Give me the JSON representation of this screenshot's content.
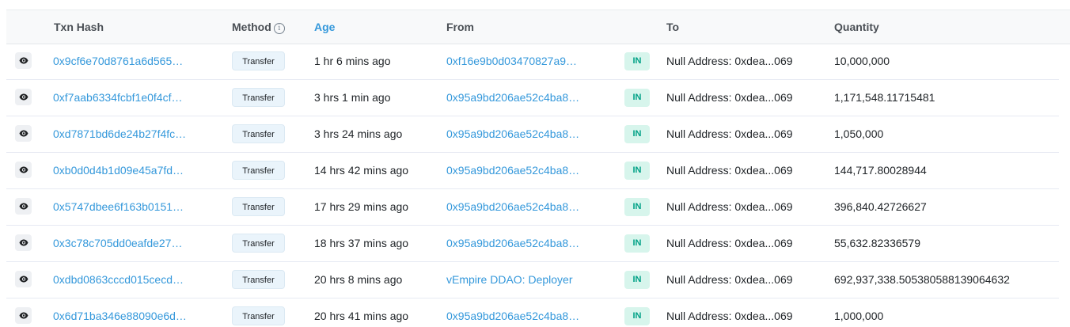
{
  "header": {
    "txn_hash": "Txn Hash",
    "method": "Method",
    "method_info": "i",
    "age": "Age",
    "from": "From",
    "to": "To",
    "quantity": "Quantity"
  },
  "icons": {
    "eye": "eye-icon",
    "info": "info-icon"
  },
  "colors": {
    "link": "#3498db",
    "in_badge_bg": "#d7f5ec",
    "in_badge_text": "#00a186"
  },
  "rows": [
    {
      "hash": "0x9cf6e70d8761a6d565…",
      "method": "Transfer",
      "age": "1 hr 6 mins ago",
      "from": "0xf16e9b0d03470827a9…",
      "direction": "IN",
      "to": "Null Address: 0xdea...069",
      "quantity": "10,000,000"
    },
    {
      "hash": "0xf7aab6334fcbf1e0f4cf…",
      "method": "Transfer",
      "age": "3 hrs 1 min ago",
      "from": "0x95a9bd206ae52c4ba8…",
      "direction": "IN",
      "to": "Null Address: 0xdea...069",
      "quantity": "1,171,548.11715481"
    },
    {
      "hash": "0xd7871bd6de24b27f4fc…",
      "method": "Transfer",
      "age": "3 hrs 24 mins ago",
      "from": "0x95a9bd206ae52c4ba8…",
      "direction": "IN",
      "to": "Null Address: 0xdea...069",
      "quantity": "1,050,000"
    },
    {
      "hash": "0xb0d0d4b1d09e45a7fd…",
      "method": "Transfer",
      "age": "14 hrs 42 mins ago",
      "from": "0x95a9bd206ae52c4ba8…",
      "direction": "IN",
      "to": "Null Address: 0xdea...069",
      "quantity": "144,717.80028944"
    },
    {
      "hash": "0x5747dbee6f163b0151…",
      "method": "Transfer",
      "age": "17 hrs 29 mins ago",
      "from": "0x95a9bd206ae52c4ba8…",
      "direction": "IN",
      "to": "Null Address: 0xdea...069",
      "quantity": "396,840.42726627"
    },
    {
      "hash": "0x3c78c705dd0eafde27…",
      "method": "Transfer",
      "age": "18 hrs 37 mins ago",
      "from": "0x95a9bd206ae52c4ba8…",
      "direction": "IN",
      "to": "Null Address: 0xdea...069",
      "quantity": "55,632.82336579"
    },
    {
      "hash": "0xdbd0863cccd015cecd…",
      "method": "Transfer",
      "age": "20 hrs 8 mins ago",
      "from": "vEmpire DDAO: Deployer",
      "direction": "IN",
      "to": "Null Address: 0xdea...069",
      "quantity": "692,937,338.505380588139064632"
    },
    {
      "hash": "0x6d71ba346e88090e6d…",
      "method": "Transfer",
      "age": "20 hrs 41 mins ago",
      "from": "0x95a9bd206ae52c4ba8…",
      "direction": "IN",
      "to": "Null Address: 0xdea...069",
      "quantity": "1,000,000"
    }
  ]
}
